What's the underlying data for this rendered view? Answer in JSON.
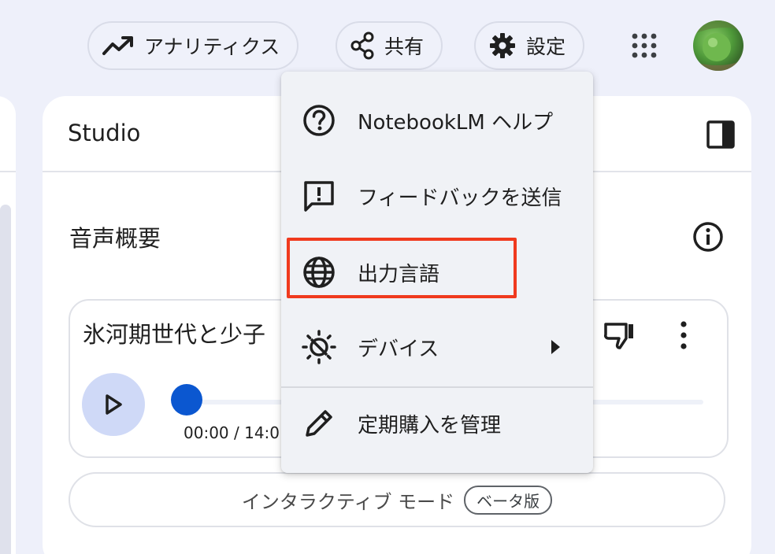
{
  "header": {
    "analytics_label": "アナリティクス",
    "share_label": "共有",
    "settings_label": "設定"
  },
  "studio": {
    "title": "Studio",
    "section_title": "音声概要",
    "audio": {
      "title": "氷河期世代と少子",
      "time": "00:00 / 14:0",
      "progress": 0
    },
    "interactive_mode": {
      "label": "インタラクティブ モード",
      "badge": "ベータ版"
    }
  },
  "settings_menu": {
    "items": [
      {
        "label": "NotebookLM ヘルプ",
        "icon": "help-circle-icon"
      },
      {
        "label": "フィードバックを送信",
        "icon": "feedback-icon"
      },
      {
        "label": "出力言語",
        "icon": "globe-icon"
      },
      {
        "label": "デバイス",
        "icon": "device-theme-icon"
      },
      {
        "label": "定期購入を管理",
        "icon": "pencil-icon"
      }
    ]
  },
  "colors": {
    "accent": "#0b57d0",
    "highlight": "#f03a1e",
    "background": "#eef0fa"
  }
}
